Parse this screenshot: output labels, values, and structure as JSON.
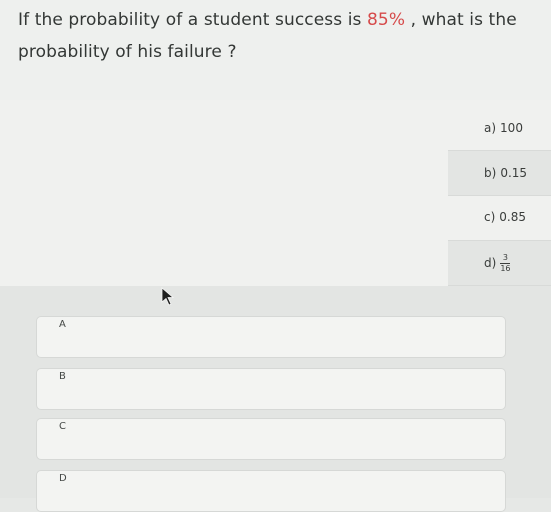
{
  "question": {
    "before": "If the probability of a student success is ",
    "highlight": "85%",
    "after": " , what is the probability of his failure ?"
  },
  "options": [
    {
      "letter": "a)",
      "text": "100"
    },
    {
      "letter": "b)",
      "text": "0.15"
    },
    {
      "letter": "c)",
      "text": "0.85"
    },
    {
      "letter": "d)",
      "numerator": "3",
      "denominator": "16"
    }
  ],
  "answers": [
    "A",
    "B",
    "C",
    "D"
  ],
  "colors": {
    "highlight": "#d64a4a",
    "background": "#e6e8e6"
  }
}
